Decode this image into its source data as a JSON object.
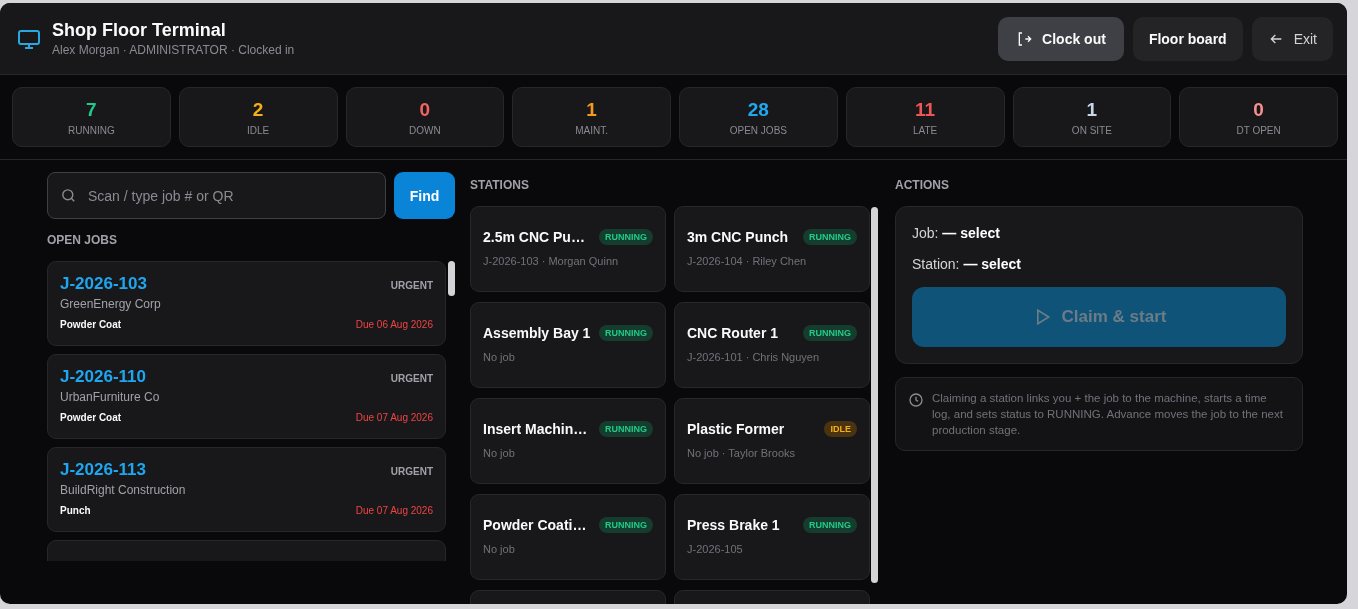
{
  "header": {
    "title": "Shop Floor Terminal",
    "subtitle": "Alex Morgan · ADMINISTRATOR · Clocked in",
    "buttons": [
      {
        "label": "Clock out",
        "kind": "clockout"
      },
      {
        "label": "Floor board",
        "kind": "plain"
      },
      {
        "label": "Exit",
        "kind": "back"
      }
    ]
  },
  "stats": [
    {
      "value": "7",
      "label": "RUNNING",
      "color": "#22c98a"
    },
    {
      "value": "2",
      "label": "IDLE",
      "color": "#f5b014"
    },
    {
      "value": "0",
      "label": "DOWN",
      "color": "#f26464"
    },
    {
      "value": "1",
      "label": "MAINT.",
      "color": "#f59a1f"
    },
    {
      "value": "28",
      "label": "OPEN JOBS",
      "color": "#20a8f0"
    },
    {
      "value": "11",
      "label": "LATE",
      "color": "#ef5656"
    },
    {
      "value": "1",
      "label": "ON SITE",
      "color": "#c8d6ea"
    },
    {
      "value": "0",
      "label": "DT OPEN",
      "color": "#f69090"
    }
  ],
  "search": {
    "placeholder": "Scan / type job # or QR",
    "button": "Find"
  },
  "open_jobs": {
    "heading": "OPEN JOBS",
    "jobs": [
      {
        "id": "J-2026-103",
        "customer": "GreenEnergy Corp",
        "stage": "Powder Coat",
        "priority": "URGENT",
        "due": "Due 06 Aug 2026",
        "late": true
      },
      {
        "id": "J-2026-110",
        "customer": "UrbanFurniture Co",
        "stage": "Powder Coat",
        "priority": "URGENT",
        "due": "Due 07 Aug 2026",
        "late": true
      },
      {
        "id": "J-2026-113",
        "customer": "BuildRight Construction",
        "stage": "Punch",
        "priority": "URGENT",
        "due": "Due 07 Aug 2026",
        "late": true
      }
    ]
  },
  "stations": {
    "heading": "STATIONS",
    "items": [
      {
        "name": "2.5m CNC Pu…",
        "detail": "J-2026-103 · Morgan Quinn",
        "status": "RUNNING"
      },
      {
        "name": "3m CNC Punch",
        "detail": "J-2026-104 · Riley Chen",
        "status": "RUNNING"
      },
      {
        "name": "Assembly Bay 1",
        "detail": "No job",
        "status": "RUNNING"
      },
      {
        "name": "CNC Router 1",
        "detail": "J-2026-101 · Chris Nguyen",
        "status": "RUNNING"
      },
      {
        "name": "Insert Machin…",
        "detail": "No job",
        "status": "RUNNING"
      },
      {
        "name": "Plastic Former",
        "detail": "No job · Taylor Brooks",
        "status": "IDLE"
      },
      {
        "name": "Powder Coati…",
        "detail": "No job",
        "status": "RUNNING"
      },
      {
        "name": "Press Brake 1",
        "detail": "J-2026-105",
        "status": "RUNNING"
      }
    ]
  },
  "actions": {
    "heading": "ACTIONS",
    "job_label": "Job:",
    "job_value": "— select",
    "station_label": "Station:",
    "station_value": "— select",
    "claim_button": {
      "label": "Claim & start",
      "disabled": true
    },
    "note": "Claiming a station links you + the job to the machine, starts a time log, and sets status to RUNNING. Advance moves the job to the next production stage."
  }
}
